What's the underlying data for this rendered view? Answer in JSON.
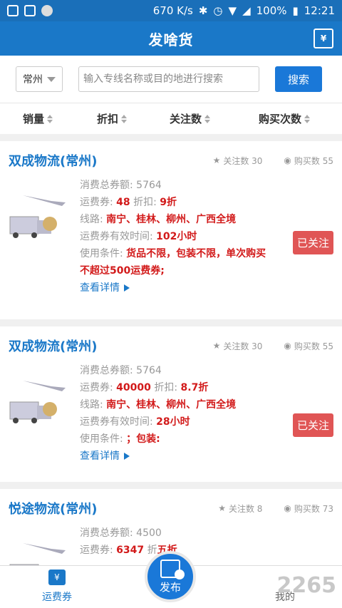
{
  "status": {
    "speed": "670 K/s",
    "battery": "100%",
    "time": "12:21"
  },
  "header": {
    "title": "发啥货",
    "bag_icon": "shopping-bag-yen-icon",
    "bag_symbol": "¥"
  },
  "search": {
    "city": "常州",
    "placeholder": "输入专线名称或目的地进行搜索",
    "button": "搜索"
  },
  "sort": [
    "销量",
    "折扣",
    "关注数",
    "购买次数"
  ],
  "cards": [
    {
      "title": "双成物流(常州)",
      "follow_label": "关注数 30",
      "buy_label": "购买数 55",
      "total_label": "消费总券额:",
      "total": "5764",
      "coupon_label": "运费券:",
      "coupon": "48",
      "discount_label": "折扣:",
      "discount": "9折",
      "route_label": "线路:",
      "route": "南宁、桂林、柳州、广西全境",
      "time_label": "运费券有效时间:",
      "time": "102小时",
      "cond_label": "使用条件:",
      "cond": "货品不限，包装不限，单次购买",
      "cond2": "不超过500运费券;",
      "detail": "查看详情",
      "followed": "已关注"
    },
    {
      "title": "双成物流(常州)",
      "follow_label": "关注数 30",
      "buy_label": "购买数 55",
      "total_label": "消费总券额:",
      "total": "5764",
      "coupon_label": "运费券:",
      "coupon": "40000",
      "discount_label": "折扣:",
      "discount": "8.7折",
      "route_label": "线路:",
      "route": "南宁、桂林、柳州、广西全境",
      "time_label": "运费券有效时间:",
      "time": "28小时",
      "cond_label": "使用条件:",
      "cond": "；包装:",
      "detail": "查看详情",
      "followed": "已关注"
    },
    {
      "title": "悦途物流(常州)",
      "follow_label": "关注数 8",
      "buy_label": "购买数 73",
      "total_label": "消费总券额:",
      "total": "4500",
      "coupon_label": "运费券:",
      "coupon": "6347",
      "discount_label": "折",
      "discount": "五折"
    }
  ],
  "nav": {
    "coupon": "运费券",
    "publish": "发布",
    "mine": "我的"
  },
  "watermark": "2265"
}
